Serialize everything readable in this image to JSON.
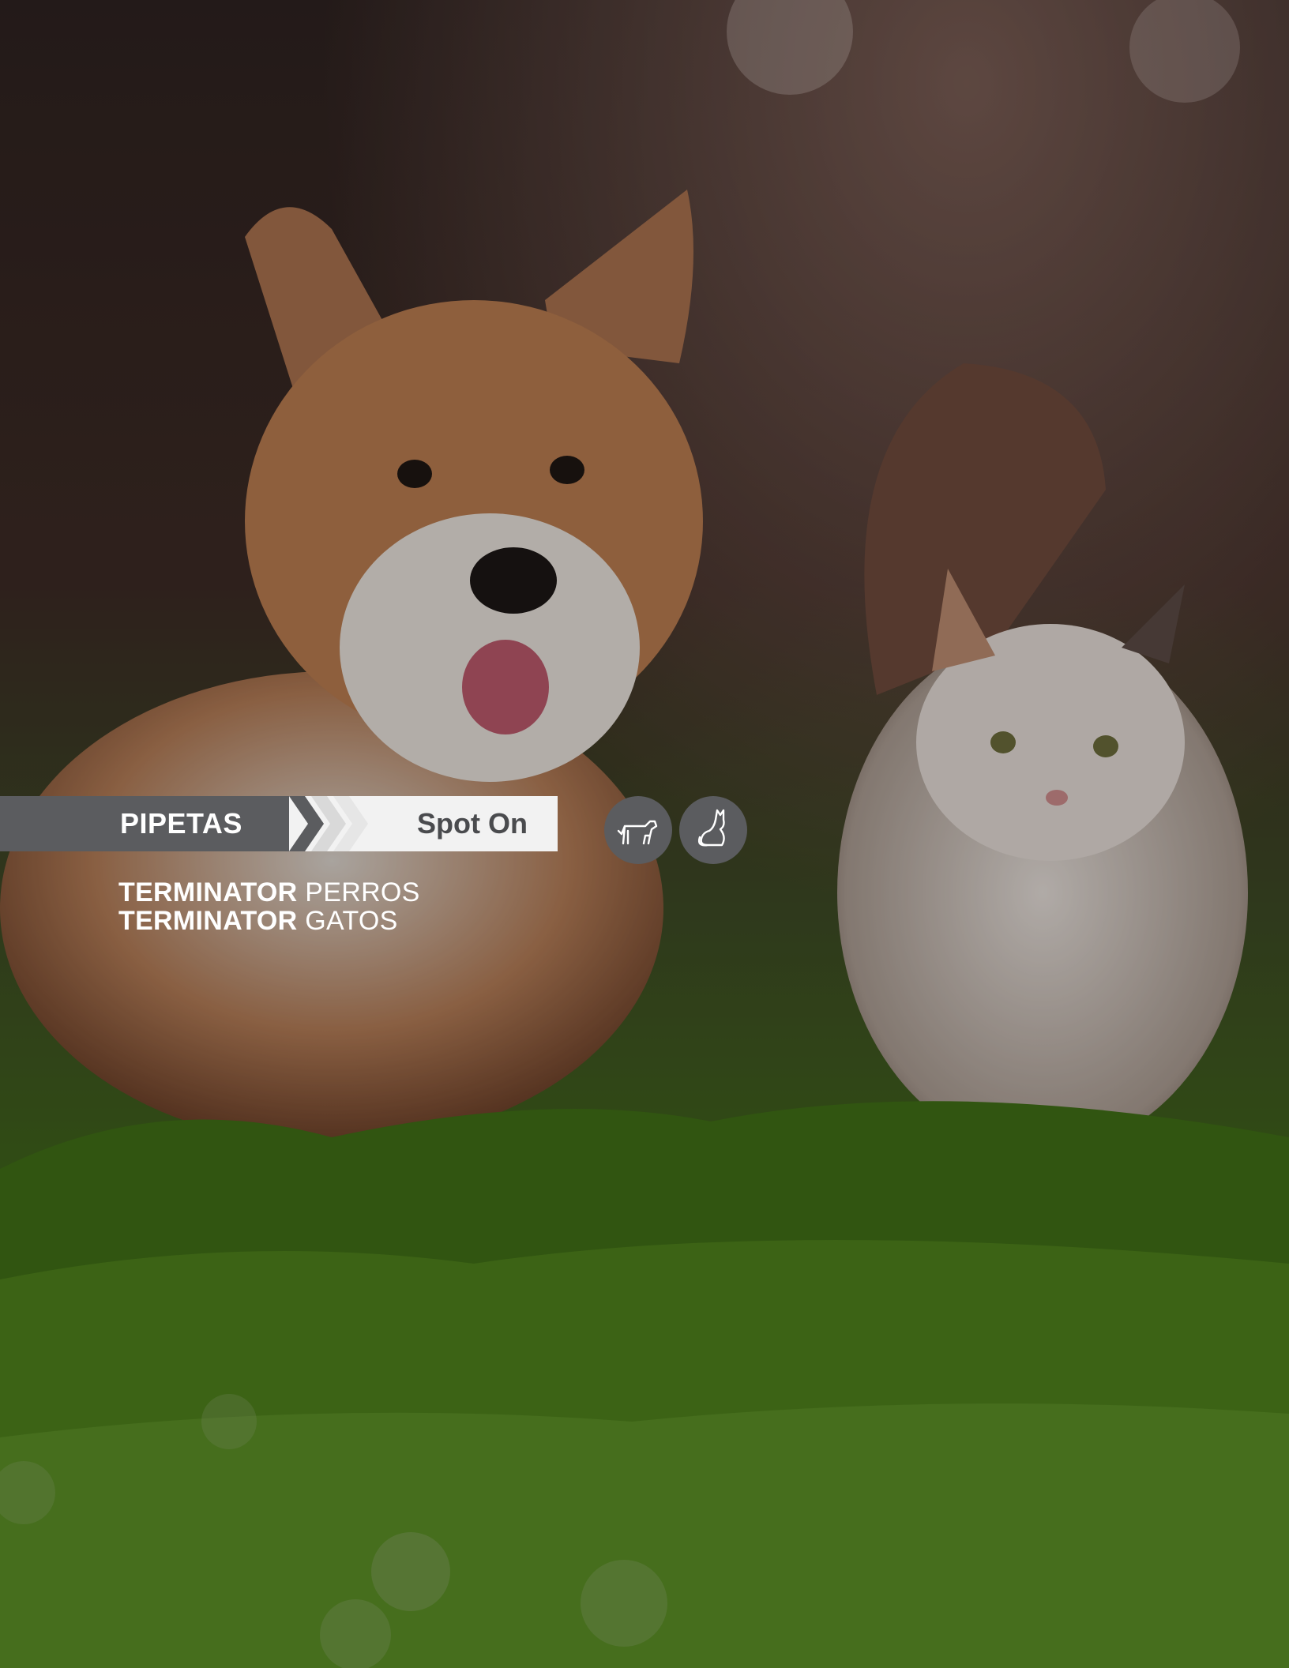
{
  "banner": {
    "category_label": "PIPETAS",
    "type_label": "Spot On"
  },
  "species_icons": [
    "dog-icon",
    "cat-icon"
  ],
  "products": [
    {
      "brand": "TERMINATOR",
      "variant": "PERROS"
    },
    {
      "brand": "TERMINATOR",
      "variant": "GATOS"
    }
  ],
  "colors": {
    "banner_dark": "#5b5c5f",
    "banner_light": "#f2f2f2",
    "text_white": "#ffffff",
    "grass_green": "#4d7f1c"
  }
}
